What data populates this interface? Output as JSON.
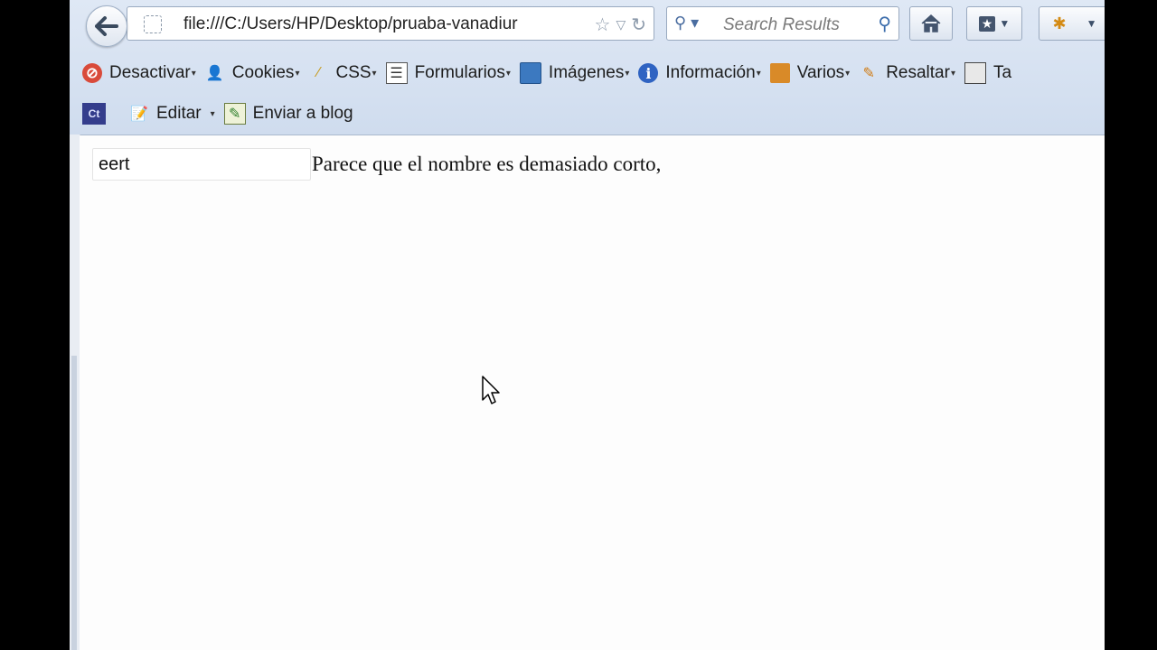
{
  "browser": {
    "url": "file:///C:/Users/HP/Desktop/pruaba-vanadiur",
    "search_placeholder": "Search Results"
  },
  "toolbar_row1": [
    {
      "label": "Desactivar",
      "icon": "stop-icon",
      "dropdown": true
    },
    {
      "label": "Cookies",
      "icon": "user-icon",
      "dropdown": true
    },
    {
      "label": "CSS",
      "icon": "magic-wand-icon",
      "dropdown": true
    },
    {
      "label": "Formularios",
      "icon": "form-icon",
      "dropdown": true
    },
    {
      "label": "Imágenes",
      "icon": "image-icon",
      "dropdown": true
    },
    {
      "label": "Información",
      "icon": "info-icon",
      "dropdown": true
    },
    {
      "label": "Varios",
      "icon": "box-icon",
      "dropdown": true
    },
    {
      "label": "Resaltar",
      "icon": "pencil-icon",
      "dropdown": true
    },
    {
      "label": "Ta",
      "icon": "table-icon",
      "dropdown": false
    }
  ],
  "toolbar_row2": {
    "ct_badge": "Ct",
    "edit_label": "Editar",
    "blog_label": "Enviar a blog"
  },
  "page": {
    "name_value": "eert",
    "message": "Parece que el nombre es demasiado corto,"
  },
  "colors": {
    "chrome_bg": "#dfe8f5",
    "accent": "#3b6cab"
  }
}
